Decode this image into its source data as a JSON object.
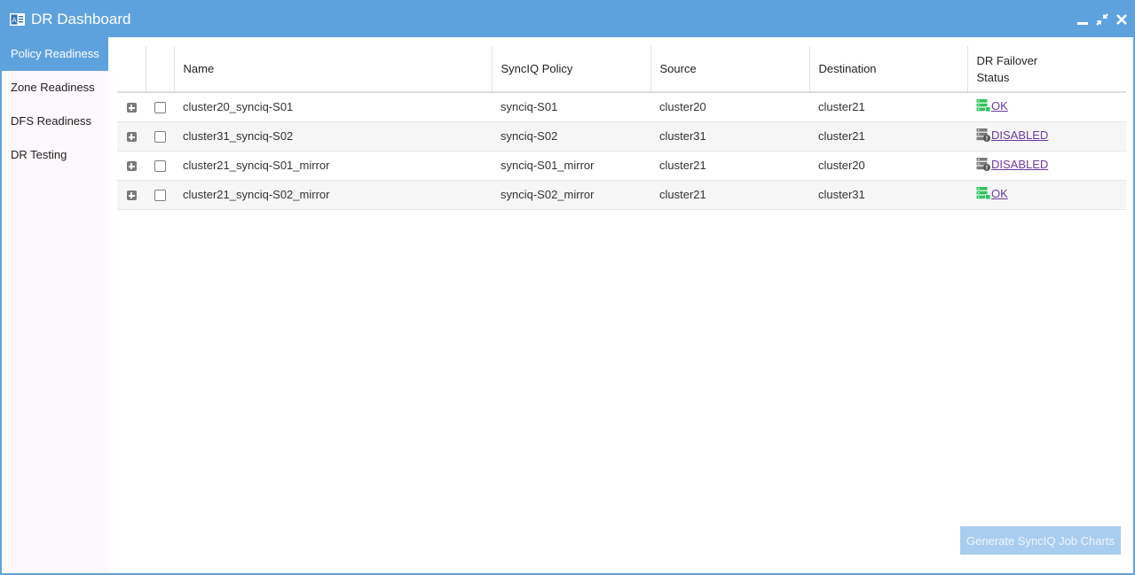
{
  "window": {
    "title": "DR Dashboard"
  },
  "titlebar_icons": [
    "app-icon",
    "minimize-icon",
    "restore-icon",
    "close-icon"
  ],
  "sidebar": {
    "items": [
      {
        "label": "Policy Readiness",
        "active": true
      },
      {
        "label": "Zone Readiness",
        "active": false
      },
      {
        "label": "DFS Readiness",
        "active": false
      },
      {
        "label": "DR Testing",
        "active": false
      }
    ]
  },
  "table": {
    "headers": {
      "name": "Name",
      "policy": "SyncIQ Policy",
      "source": "Source",
      "destination": "Destination",
      "status_line1": "DR Failover",
      "status_line2": "Status"
    },
    "rows": [
      {
        "name": "cluster20_synciq-S01",
        "policy": "synciq-S01",
        "source": "cluster20",
        "destination": "cluster21",
        "status": " OK",
        "status_icon": "server-ok-icon"
      },
      {
        "name": "cluster31_synciq-S02",
        "policy": "synciq-S02",
        "source": "cluster31",
        "destination": "cluster21",
        "status": " DISABLED",
        "status_icon": "server-warning-icon"
      },
      {
        "name": "cluster21_synciq-S01_mirror",
        "policy": "synciq-S01_mirror",
        "source": "cluster21",
        "destination": "cluster20",
        "status": " DISABLED",
        "status_icon": "server-warning-icon"
      },
      {
        "name": "cluster21_synciq-S02_mirror",
        "policy": "synciq-S02_mirror",
        "source": "cluster21",
        "destination": "cluster31",
        "status": " OK",
        "status_icon": "server-ok-icon"
      }
    ]
  },
  "footer": {
    "generate_button": "Generate SyncIQ Job Charts"
  },
  "colors": {
    "accent": "#5ea2dd",
    "ok": "#2fc45a",
    "disabled": "#777777",
    "link": "#6a3aa0",
    "button_disabled": "#a9cdee"
  }
}
